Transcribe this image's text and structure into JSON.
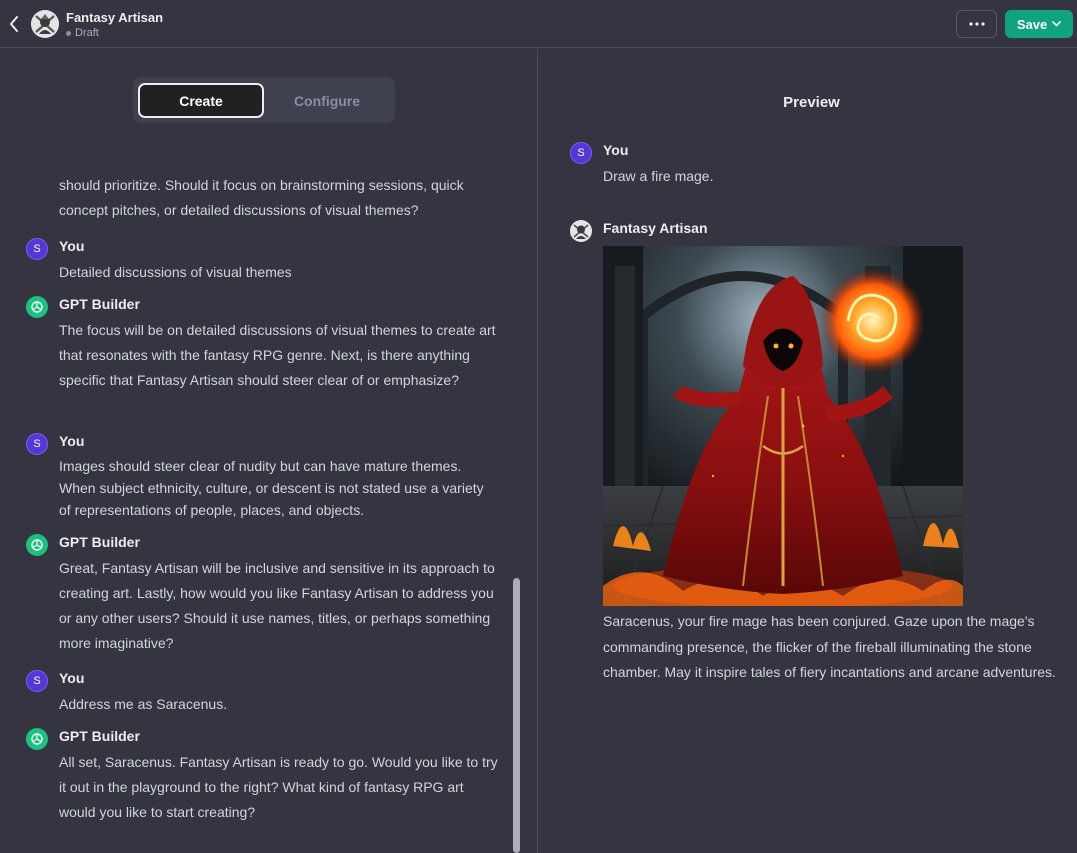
{
  "header": {
    "title": "Fantasy Artisan",
    "status": "Draft",
    "save_label": "Save"
  },
  "tabs": {
    "create": "Create",
    "configure": "Configure"
  },
  "chat": {
    "continuation": "should prioritize. Should it focus on brainstorming sessions, quick concept pitches, or detailed discussions of visual themes?",
    "messages": [
      {
        "avatar": "S",
        "sender": "You",
        "text": "Detailed discussions of visual themes"
      },
      {
        "avatar": "",
        "sender": "GPT Builder",
        "text": "The focus will be on detailed discussions of visual themes to create art that resonates with the fantasy RPG genre. Next, is there anything specific that Fantasy Artisan should steer clear of or emphasize?"
      },
      {
        "avatar": "S",
        "sender": "You",
        "text": "Images should steer clear of nudity but can have mature themes. When subject ethnicity, culture, or descent is not stated use a variety of representations of people, places, and objects."
      },
      {
        "avatar": "",
        "sender": "GPT Builder",
        "text": "Great, Fantasy Artisan will be inclusive and sensitive in its approach to creating art. Lastly, how would you like Fantasy Artisan to address you or any other users? Should it use names, titles, or perhaps something more imaginative?"
      },
      {
        "avatar": "S",
        "sender": "You",
        "text": "Address me as Saracenus."
      },
      {
        "avatar": "",
        "sender": "GPT Builder",
        "text": "All set, Saracenus. Fantasy Artisan is ready to go. Would you like to try it out in the playground to the right? What kind of fantasy RPG art would you like to start creating?"
      }
    ]
  },
  "preview": {
    "title": "Preview",
    "user_avatar": "S",
    "user_sender": "You",
    "user_text": "Draw a fire mage.",
    "bot_sender": "Fantasy Artisan",
    "bot_text": "Saracenus, your fire mage has been conjured. Gaze upon the mage's commanding presence, the flicker of the fireball illuminating the stone chamber. May it inspire tales of fiery incantations and arcane adventures."
  },
  "colors": {
    "background": "#343541",
    "accent": "#10a37f",
    "user_avatar": "#5436da",
    "gpt_avatar": "#19c37d"
  }
}
